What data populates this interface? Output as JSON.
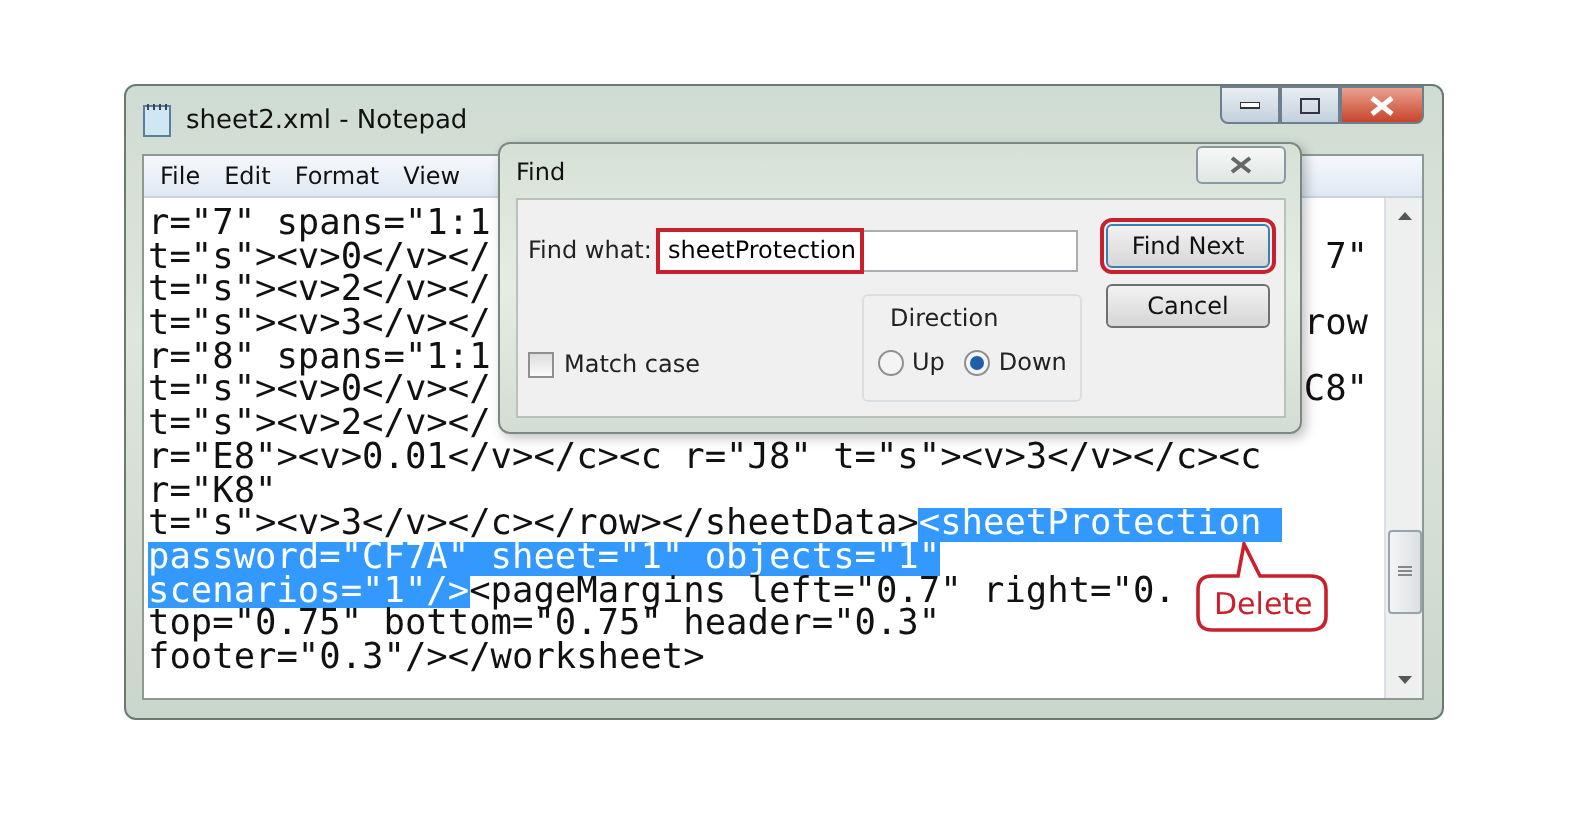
{
  "window": {
    "title": "sheet2.xml - Notepad"
  },
  "menu": [
    "File",
    "Edit",
    "Format",
    "View"
  ],
  "editor": {
    "lines": [
      {
        "segments": [
          {
            "text": "r=\"7\" spans=\"1:1",
            "selected": false
          }
        ]
      },
      {
        "segments": [
          {
            "text": "t=\"s\"><v>0</v></",
            "selected": false
          }
        ],
        "right": "7\""
      },
      {
        "segments": [
          {
            "text": "t=\"s\"><v>2</v></",
            "selected": false
          }
        ]
      },
      {
        "segments": [
          {
            "text": "t=\"s\"><v>3</v></",
            "selected": false
          }
        ],
        "right": "row"
      },
      {
        "segments": [
          {
            "text": "r=\"8\" spans=\"1:1",
            "selected": false
          }
        ]
      },
      {
        "segments": [
          {
            "text": "t=\"s\"><v>0</v></",
            "selected": false
          }
        ],
        "right": "C8\""
      },
      {
        "segments": [
          {
            "text": "t=\"s\"><v>2</v></",
            "selected": false
          }
        ]
      },
      {
        "segments": [
          {
            "text": "r=\"E8\"><v>0.01</v></c><c r=\"J8\" t=\"s\"><v>3</v></c><c",
            "selected": false
          }
        ]
      },
      {
        "segments": [
          {
            "text": "r=\"K8\"",
            "selected": false
          }
        ]
      },
      {
        "segments": [
          {
            "text": "t=\"s\"><v>3</v></c></row></sheetData>",
            "selected": false
          },
          {
            "text": "<sheetProtection ",
            "selected": true
          }
        ]
      },
      {
        "segments": [
          {
            "text": "password=\"CF7A\" sheet=\"1\" objects=\"1\"",
            "selected": true
          }
        ]
      },
      {
        "segments": [
          {
            "text": "scenarios=\"1\"/>",
            "selected": true
          },
          {
            "text": "<pageMargins left=\"0.7\" right=\"0.",
            "selected": false
          }
        ]
      },
      {
        "segments": [
          {
            "text": "top=\"0.75\" bottom=\"0.75\" header=\"0.3\"",
            "selected": false
          }
        ]
      },
      {
        "segments": [
          {
            "text": "footer=\"0.3\"/></worksheet>",
            "selected": false
          }
        ]
      }
    ]
  },
  "callout": {
    "text": "Delete"
  },
  "find_dialog": {
    "title": "Find",
    "find_what": {
      "label": "Find what:",
      "value": "sheetProtection",
      "annotated": true
    },
    "match_case": {
      "label": "Match case",
      "checked": false
    },
    "direction": {
      "label": "Direction",
      "options": [
        {
          "label": "Up",
          "selected": false
        },
        {
          "label": "Down",
          "selected": true
        }
      ]
    },
    "buttons": [
      {
        "label": "Find Next",
        "annotated": true
      },
      {
        "label": "Cancel",
        "annotated": false
      }
    ]
  }
}
